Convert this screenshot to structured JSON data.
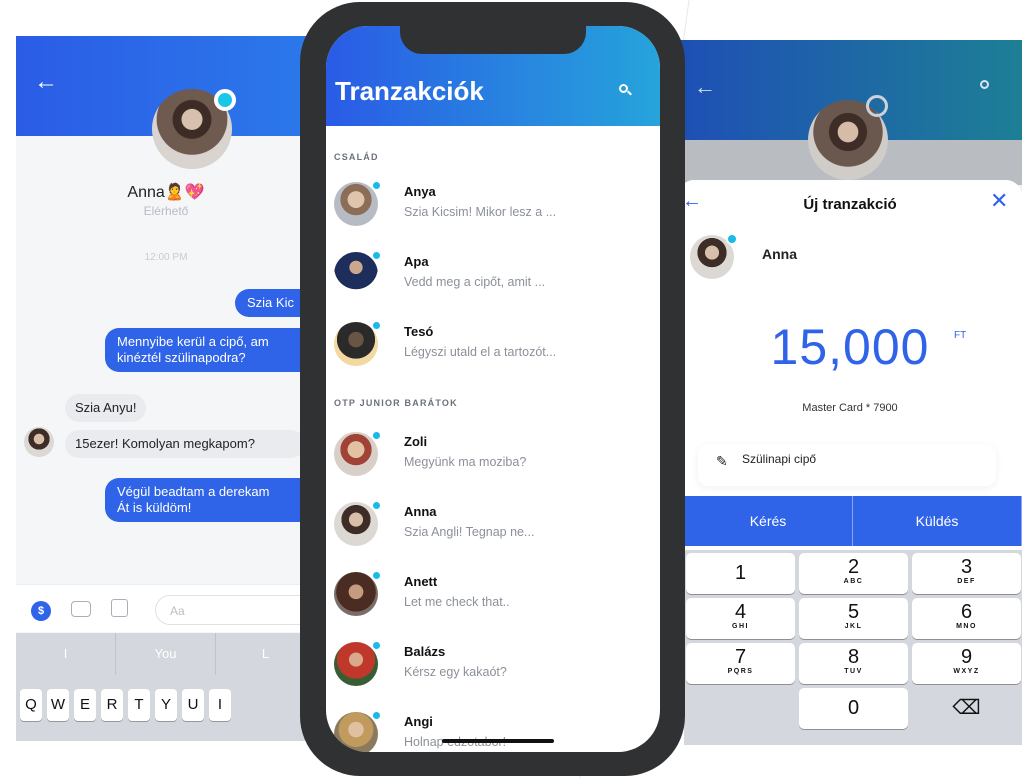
{
  "left_chat": {
    "contact_name": "Anna🙎💖",
    "status": "Elérhető",
    "time": "12:00 PM",
    "messages": [
      {
        "dir": "out",
        "text": "Szia Kic"
      },
      {
        "dir": "out",
        "text": "Mennyibe kerül a cipő, am\nkinéztél szülinapodra?"
      },
      {
        "dir": "in",
        "text": "Szia Anyu!"
      },
      {
        "dir": "in",
        "text": "15ezer! Komolyan megkapom?"
      },
      {
        "dir": "out",
        "text": "Végül beadtam a derekam\nÁt is küldöm!"
      }
    ],
    "input_placeholder": "Aa",
    "suggestions": [
      "I",
      "You",
      "L"
    ],
    "keys": [
      "Q",
      "W",
      "E",
      "R",
      "T",
      "Y",
      "U",
      "I"
    ]
  },
  "center": {
    "title": "Tranzakciók",
    "sections": [
      {
        "label": "CSALÁD",
        "items": [
          {
            "name": "Anya",
            "msg": "Szia Kicsim! Mikor lesz a ..."
          },
          {
            "name": "Apa",
            "msg": "Vedd meg a cipőt, amit ..."
          },
          {
            "name": "Tesó",
            "msg": "Légyszi utald el a tartozót..."
          }
        ]
      },
      {
        "label": "OTP JUNIOR BARÁTOK",
        "items": [
          {
            "name": "Zoli",
            "msg": "Megyünk ma moziba?"
          },
          {
            "name": "Anna",
            "msg": "Szia Angli! Tegnap ne..."
          },
          {
            "name": "Anett",
            "msg": "Let me check that.."
          },
          {
            "name": "Balázs",
            "msg": "Kérsz egy kakaót?"
          },
          {
            "name": "Angi",
            "msg": "Holnap edzotabor!"
          }
        ]
      }
    ]
  },
  "right_tx": {
    "title": "Új tranzakció",
    "recipient": "Anna",
    "amount": "15,000",
    "currency": "FT",
    "card": "Master Card * 7900",
    "note": "Szülinapi cipő",
    "actions": [
      "Kérés",
      "Küldés"
    ],
    "keypad": [
      {
        "n": "1",
        "l": ""
      },
      {
        "n": "2",
        "l": "ABC"
      },
      {
        "n": "3",
        "l": "DEF"
      },
      {
        "n": "4",
        "l": "GHI"
      },
      {
        "n": "5",
        "l": "JKL"
      },
      {
        "n": "6",
        "l": "MNO"
      },
      {
        "n": "7",
        "l": "PQRS"
      },
      {
        "n": "8",
        "l": "TUV"
      },
      {
        "n": "9",
        "l": "WXYZ"
      },
      {
        "n": "",
        "l": ""
      },
      {
        "n": "0",
        "l": ""
      },
      {
        "n": "⌫",
        "l": ""
      }
    ]
  },
  "colors": {
    "accent_blue": "#2f63e8",
    "online_dot": "#19b9ea",
    "phone_frame": "#2f3133"
  }
}
